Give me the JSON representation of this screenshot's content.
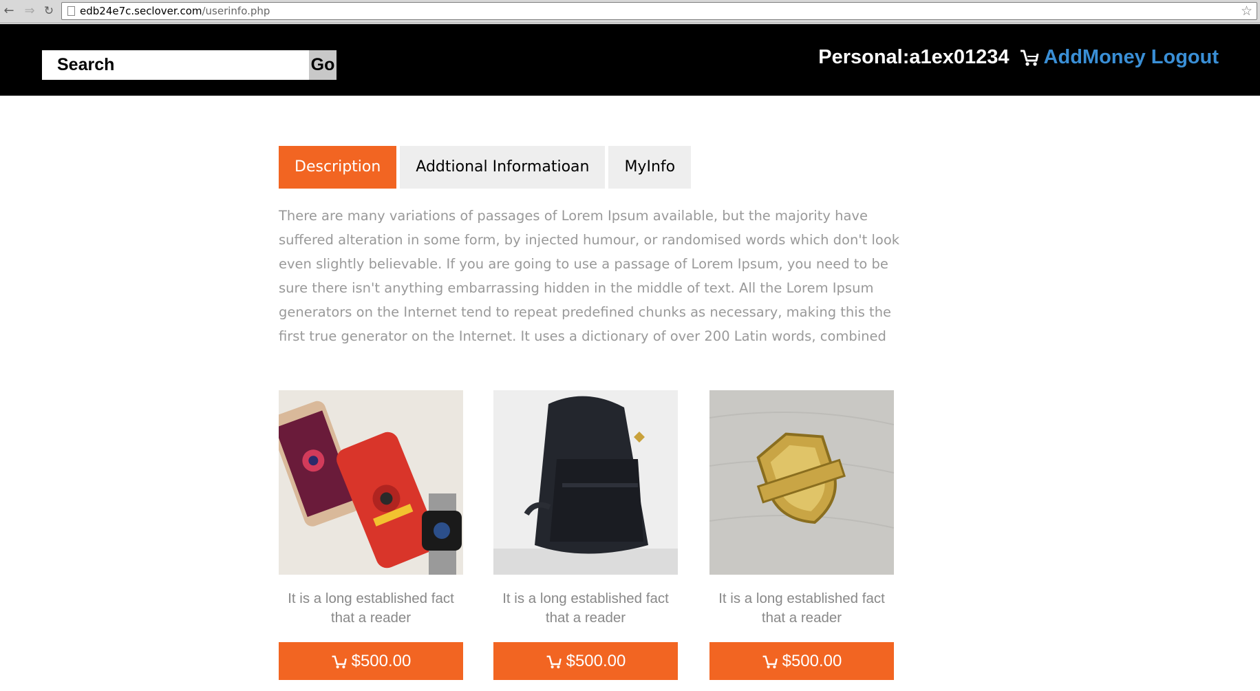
{
  "browser": {
    "url_host": "edb24e7c.seclover.com",
    "url_path": "/userinfo.php",
    "icons": [
      "back-icon",
      "forward-icon",
      "reload-icon",
      "page-icon",
      "bookmark-star-icon"
    ]
  },
  "header": {
    "search_label": "Search",
    "go_label": "Go",
    "personal": "Personal:a1ex01234",
    "add_money": "AddMoney",
    "logout": "Logout",
    "link_color": "#3a8fd6"
  },
  "tabs": [
    {
      "label": "Description",
      "active": true
    },
    {
      "label": "Addtional Informatioan",
      "active": false
    },
    {
      "label": "MyInfo",
      "active": false
    }
  ],
  "description": "There are many variations of passages of Lorem Ipsum available, but the majority have suffered alteration in some form, by injected humour, or randomised words which don't look even slightly believable. If you are going to use a passage of Lorem Ipsum, you need to be sure there isn't anything embarrassing hidden in the middle of text. All the Lorem Ipsum generators on the Internet tend to repeat predefined chunks as necessary, making this the first true generator on the Internet. It uses a dictionary of over 200 Latin words, combined",
  "products": [
    {
      "image": "phones-and-watch-image",
      "desc": "It is a long established fact that a reader",
      "price": "$500.00"
    },
    {
      "image": "backpack-image",
      "desc": "It is a long established fact that a reader",
      "price": "$500.00"
    },
    {
      "image": "afsrg-badge-pin-image",
      "desc": "It is a long established fact that a reader",
      "price": "$500.00"
    }
  ],
  "accent_color": "#f26522"
}
